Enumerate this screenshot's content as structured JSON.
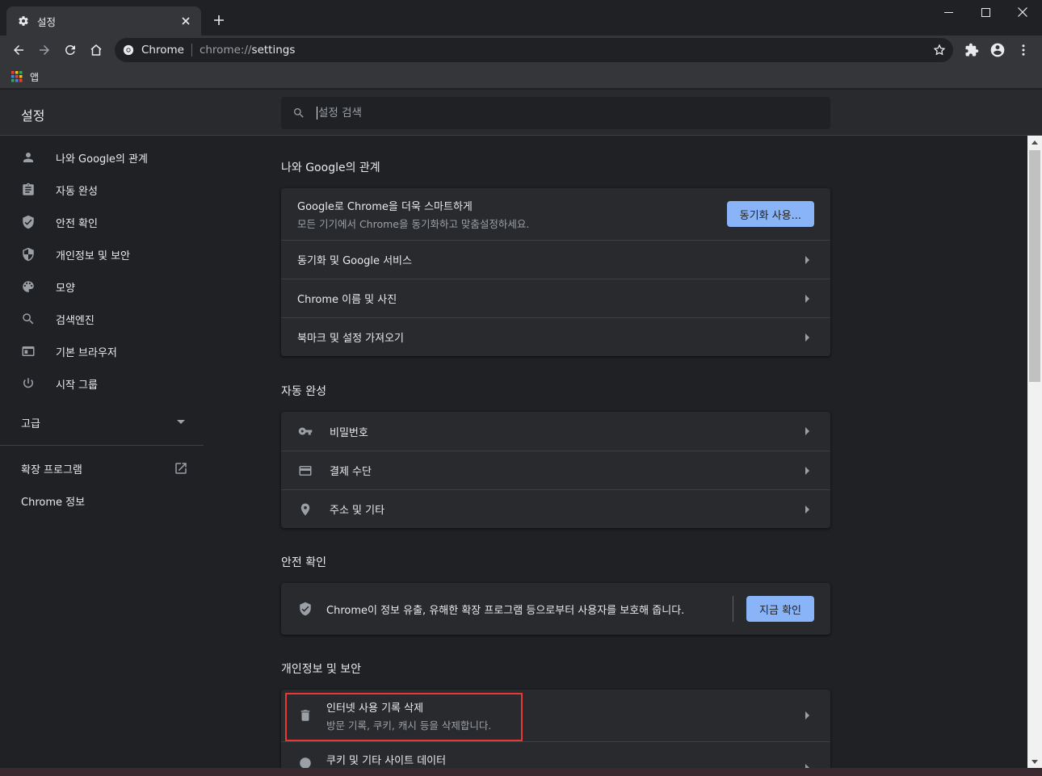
{
  "tab": {
    "title": "설정",
    "icon": "gear-icon"
  },
  "window_controls": [
    "minimize-icon",
    "maximize-icon",
    "close-icon"
  ],
  "omnibox": {
    "site_name": "Chrome",
    "url_scheme": "chrome://",
    "url_host": "settings"
  },
  "bookmarks": {
    "apps_label": "앱"
  },
  "settings": {
    "title": "설정",
    "search_placeholder": "설정 검색"
  },
  "sidebar": {
    "items": [
      {
        "label": "나와 Google의 관계",
        "icon": "person-icon"
      },
      {
        "label": "자동 완성",
        "icon": "clipboard-icon"
      },
      {
        "label": "안전 확인",
        "icon": "shield-check-icon"
      },
      {
        "label": "개인정보 및 보안",
        "icon": "shield-half-icon"
      },
      {
        "label": "모양",
        "icon": "palette-icon"
      },
      {
        "label": "검색엔진",
        "icon": "search-icon"
      },
      {
        "label": "기본 브라우저",
        "icon": "browser-icon"
      },
      {
        "label": "시작 그룹",
        "icon": "power-icon"
      }
    ],
    "advanced": "고급",
    "extensions": "확장 프로그램",
    "about": "Chrome 정보"
  },
  "sections": {
    "you_and_google": {
      "title": "나와 Google의 관계",
      "sync_title": "Google로 Chrome을 더욱 스마트하게",
      "sync_sub": "모든 기기에서 Chrome을 동기화하고 맞춤설정하세요.",
      "sync_button": "동기화 사용...",
      "rows": [
        "동기화 및 Google 서비스",
        "Chrome 이름 및 사진",
        "북마크 및 설정 가져오기"
      ]
    },
    "autofill": {
      "title": "자동 완성",
      "rows": [
        {
          "label": "비밀번호",
          "icon": "key-icon"
        },
        {
          "label": "결제 수단",
          "icon": "credit-card-icon"
        },
        {
          "label": "주소 및 기타",
          "icon": "location-pin-icon"
        }
      ]
    },
    "safety": {
      "title": "안전 확인",
      "text": "Chrome이 정보 유출, 유해한 확장 프로그램 등으로부터 사용자를 보호해 줍니다.",
      "button": "지금 확인"
    },
    "privacy": {
      "title": "개인정보 및 보안",
      "clear_title": "인터넷 사용 기록 삭제",
      "clear_sub": "방문 기록, 쿠키, 캐시 등을 삭제합니다.",
      "cookies_title": "쿠키 및 기타 사이트 데이터"
    }
  },
  "colors": {
    "accent": "#8ab4f8",
    "highlight": "#e53935",
    "background": "#202124",
    "card": "#292a2d"
  }
}
